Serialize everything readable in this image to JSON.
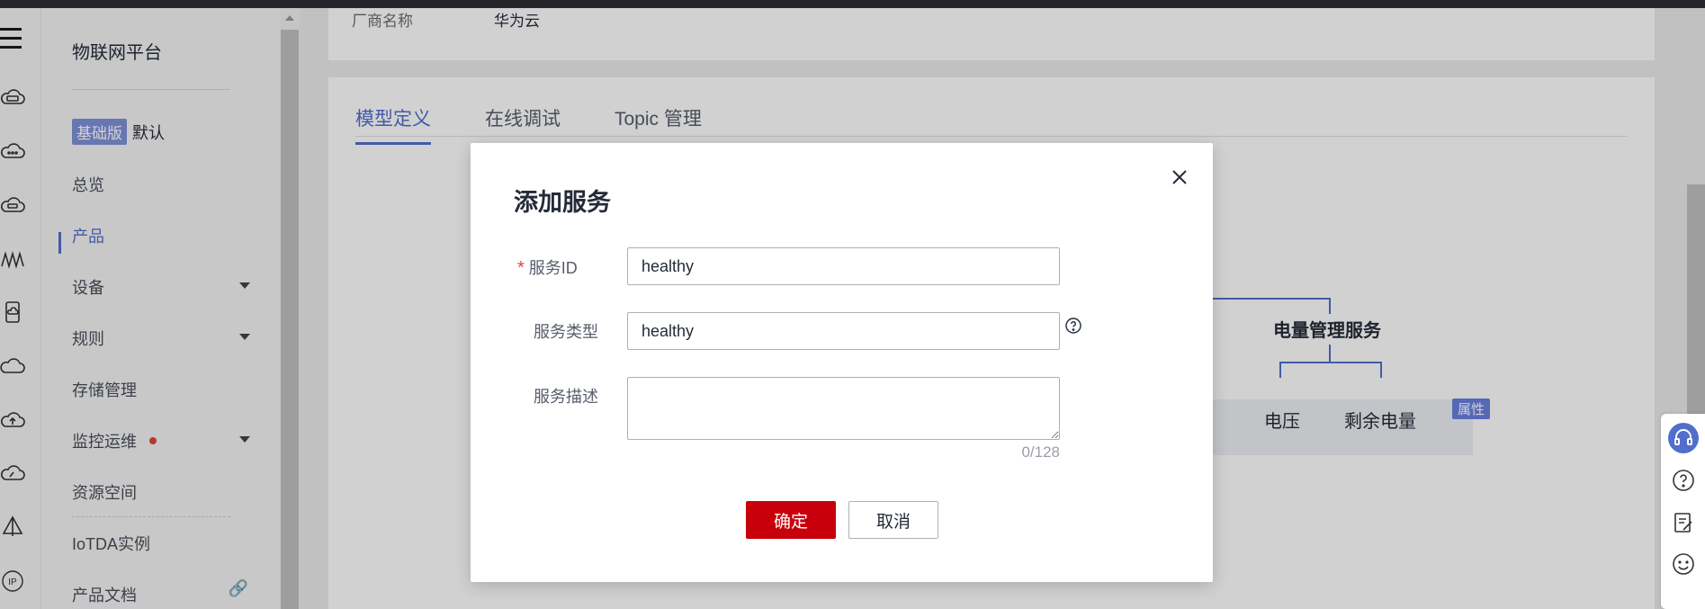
{
  "sidebar": {
    "title": "物联网平台",
    "edition": {
      "badge": "基础版",
      "instance": "默认"
    },
    "items": [
      {
        "label": "总览"
      },
      {
        "label": "产品"
      },
      {
        "label": "设备"
      },
      {
        "label": "规则"
      },
      {
        "label": "存储管理"
      },
      {
        "label": "监控运维"
      },
      {
        "label": "资源空间"
      },
      {
        "label": "IoTDA实例"
      },
      {
        "label": "产品文档"
      }
    ],
    "active_item": "产品"
  },
  "product_info": {
    "vendor_label": "厂商名称",
    "vendor_value": "华为云"
  },
  "tabs": [
    {
      "label": "模型定义",
      "active": true
    },
    {
      "label": "在线调试",
      "active": false
    },
    {
      "label": "Topic 管理",
      "active": false
    }
  ],
  "model_tree": {
    "service_node": "电量管理服务",
    "properties": [
      "电压",
      "剩余电量"
    ],
    "property_tag": "属性"
  },
  "dialog": {
    "title": "添加服务",
    "fields": {
      "service_id": {
        "label": "服务ID",
        "value": "healthy",
        "required": true
      },
      "service_type": {
        "label": "服务类型",
        "value": "healthy"
      },
      "service_desc": {
        "label": "服务描述",
        "value": "",
        "counter": "0/128"
      }
    },
    "buttons": {
      "ok": "确定",
      "cancel": "取消"
    }
  },
  "colors": {
    "accent": "#526ecc",
    "primary_button": "#c7000b",
    "required_mark": "#e04343",
    "alert_dot": "#e0453a"
  },
  "icons": {
    "rail": [
      "menu-icon",
      "cloud-server-icon",
      "cloud-more-icon",
      "cloud-device-icon",
      "signal-wave-icon",
      "mobile-cloud-icon",
      "cloud-icon",
      "cloud-upload-icon",
      "cloud-gauge-icon",
      "sail-icon",
      "ip-icon"
    ],
    "float": [
      "headset-icon",
      "help-circle-icon",
      "edit-note-icon",
      "smile-icon"
    ]
  }
}
